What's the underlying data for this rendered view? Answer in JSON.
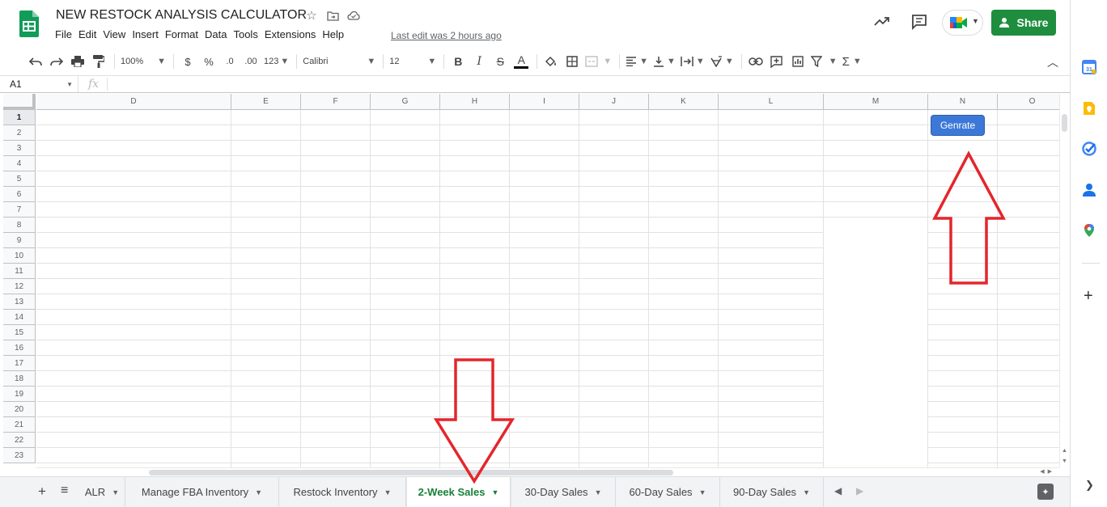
{
  "header": {
    "title": "NEW RESTOCK ANALYSIS CALCULATOR",
    "last_edit": "Last edit was 2 hours ago",
    "share_label": "Share"
  },
  "menu": [
    "File",
    "Edit",
    "View",
    "Insert",
    "Format",
    "Data",
    "Tools",
    "Extensions",
    "Help"
  ],
  "toolbar": {
    "zoom": "100%",
    "currency": "$",
    "percent": "%",
    "decrease_decimal": ".0",
    "increase_decimal": ".00",
    "more_formats": "123",
    "font": "Calibri",
    "font_size": "12",
    "bold": "B",
    "italic": "I",
    "strike": "S",
    "text_color": "A"
  },
  "formula_bar": {
    "cell_ref": "A1",
    "fx": "fx"
  },
  "columns": [
    "D",
    "E",
    "F",
    "G",
    "H",
    "I",
    "J",
    "K",
    "L",
    "M",
    "N",
    "O"
  ],
  "rows": [
    "1",
    "2",
    "3",
    "4",
    "5",
    "6",
    "7",
    "8",
    "9",
    "10",
    "11",
    "12",
    "13",
    "14",
    "15",
    "16",
    "17",
    "18",
    "19",
    "20",
    "21",
    "22",
    "23"
  ],
  "sheet_button": {
    "label": "Genrate"
  },
  "sheet_tabs": [
    {
      "label": "ALR",
      "active": false
    },
    {
      "label": "Manage FBA Inventory",
      "active": false
    },
    {
      "label": "Restock Inventory",
      "active": false
    },
    {
      "label": "2-Week Sales",
      "active": true
    },
    {
      "label": "30-Day Sales",
      "active": false
    },
    {
      "label": "60-Day Sales",
      "active": false
    },
    {
      "label": "90-Day Sales",
      "active": false
    }
  ],
  "colors": {
    "accent_green": "#1e8e3e",
    "active_tab_text": "#188038",
    "button_blue": "#3c78d8",
    "annotation_red": "#e3262c"
  },
  "icons": {
    "star": "star-icon",
    "move": "move-to-folder-icon",
    "cloud": "cloud-status-icon",
    "trend": "trending-up-icon",
    "comment": "comment-icon",
    "meet": "google-meet-icon",
    "explore": "explore-icon"
  }
}
